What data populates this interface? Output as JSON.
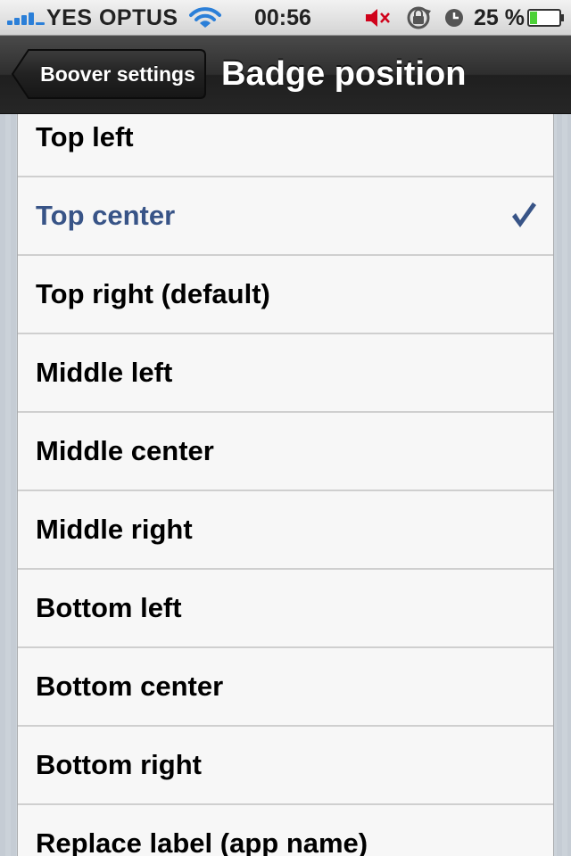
{
  "status_bar": {
    "carrier": "YES OPTUS",
    "time": "00:56",
    "battery_percent": "25 %",
    "battery_level": 0.25,
    "signal_bars": 5,
    "icons": [
      "signal-icon",
      "wifi-icon",
      "mute-icon",
      "rotation-lock-icon",
      "alarm-icon",
      "battery-icon"
    ]
  },
  "nav_bar": {
    "back_label": "Boover settings",
    "title": "Badge position"
  },
  "options": [
    {
      "label": "Top left",
      "selected": false
    },
    {
      "label": "Top center",
      "selected": true
    },
    {
      "label": "Top right (default)",
      "selected": false
    },
    {
      "label": "Middle left",
      "selected": false
    },
    {
      "label": "Middle center",
      "selected": false
    },
    {
      "label": "Middle right",
      "selected": false
    },
    {
      "label": "Bottom left",
      "selected": false
    },
    {
      "label": "Bottom center",
      "selected": false
    },
    {
      "label": "Bottom right",
      "selected": false
    },
    {
      "label": "Replace label (app name)",
      "selected": false
    }
  ],
  "colors": {
    "selected_text": "#385487",
    "checkmark": "#385487",
    "signal": "#2b7fd8",
    "battery_fill": "#4cd137"
  }
}
